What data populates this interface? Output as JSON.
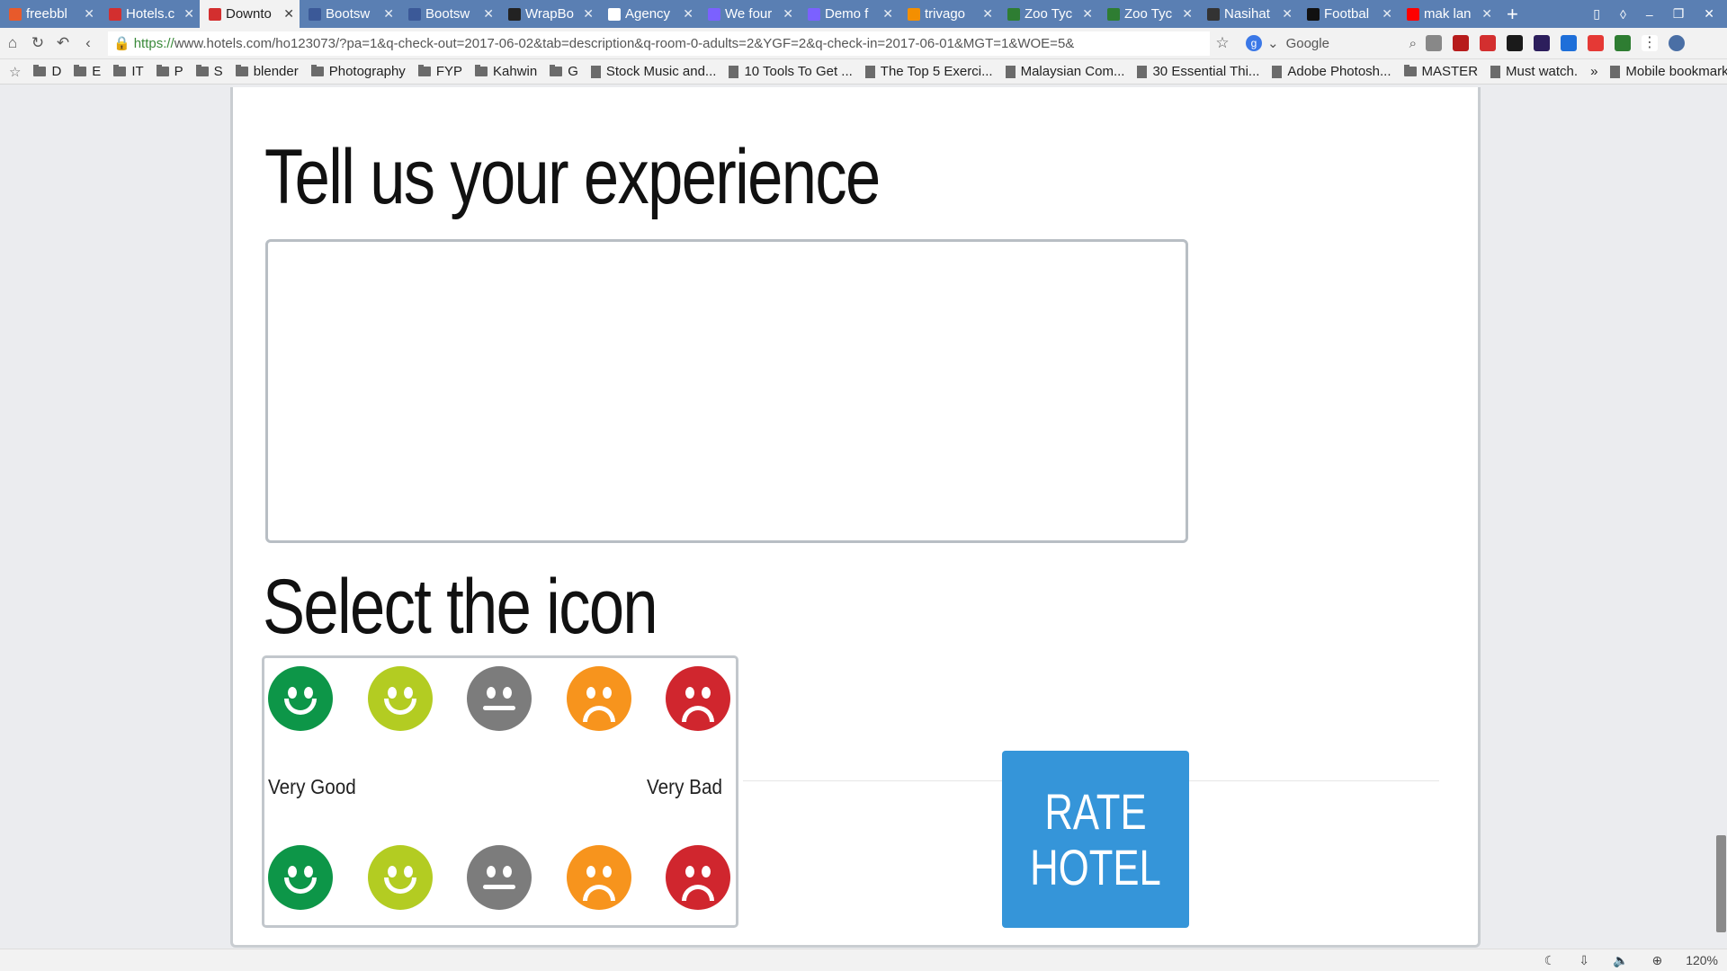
{
  "tabs": [
    {
      "label": "freebbl",
      "color": "#e85a2b",
      "active": false
    },
    {
      "label": "Hotels.c",
      "color": "#d32f2f",
      "active": false
    },
    {
      "label": "Downto",
      "color": "#d32f2f",
      "active": true
    },
    {
      "label": "Bootsw",
      "color": "#3b5998",
      "active": false
    },
    {
      "label": "Bootsw",
      "color": "#3b5998",
      "active": false
    },
    {
      "label": "WrapBo",
      "color": "#222222",
      "active": false
    },
    {
      "label": "Agency",
      "color": "#ffffff",
      "active": false
    },
    {
      "label": "We four",
      "color": "#7b61ff",
      "active": false
    },
    {
      "label": "Demo f",
      "color": "#7b61ff",
      "active": false
    },
    {
      "label": "trivago",
      "color": "#f48f00",
      "active": false
    },
    {
      "label": "Zoo Tyc",
      "color": "#2e7d32",
      "active": false
    },
    {
      "label": "Zoo Tyc",
      "color": "#2e7d32",
      "active": false
    },
    {
      "label": "Nasihat",
      "color": "#333333",
      "active": false
    },
    {
      "label": "Footbal",
      "color": "#111111",
      "active": false
    },
    {
      "label": "mak lan",
      "color": "#ff0000",
      "active": false
    }
  ],
  "toolbar": {
    "url_prefix": "https://",
    "url": "www.hotels.com/ho123073/?pa=1&q-check-out=2017-06-02&tab=description&q-room-0-adults=2&YGF=2&q-check-in=2017-06-01&MGT=1&WOE=5&",
    "search_engine": "Google"
  },
  "bookmarks": [
    {
      "label": "D",
      "type": "folder"
    },
    {
      "label": "E",
      "type": "folder"
    },
    {
      "label": "IT",
      "type": "folder"
    },
    {
      "label": "P",
      "type": "folder"
    },
    {
      "label": "S",
      "type": "folder"
    },
    {
      "label": "blender",
      "type": "folder"
    },
    {
      "label": "Photography",
      "type": "folder"
    },
    {
      "label": "FYP",
      "type": "folder"
    },
    {
      "label": "Kahwin",
      "type": "folder"
    },
    {
      "label": "G",
      "type": "folder"
    },
    {
      "label": "Stock Music and...",
      "type": "page"
    },
    {
      "label": "10 Tools To Get ...",
      "type": "page"
    },
    {
      "label": "The Top 5 Exerci...",
      "type": "page"
    },
    {
      "label": "Malaysian Com...",
      "type": "page"
    },
    {
      "label": "30 Essential Thi...",
      "type": "page"
    },
    {
      "label": "Adobe Photosh...",
      "type": "page"
    },
    {
      "label": "MASTER",
      "type": "folder"
    },
    {
      "label": "Must watch.",
      "type": "page"
    }
  ],
  "bookmarks_more": "»",
  "mobile_bookmarks": "Mobile bookmarks",
  "main": {
    "heading_experience": "Tell us your experience",
    "heading_icon": "Select the icon",
    "label_good": "Very Good",
    "label_bad": "Very Bad",
    "rate_line1": "RATE",
    "rate_line2": "HOTEL"
  },
  "faces": [
    {
      "name": "very-good",
      "mood": "smile",
      "color": "#0d9648"
    },
    {
      "name": "good",
      "mood": "smile",
      "color": "#b3cc22"
    },
    {
      "name": "neutral",
      "mood": "flat",
      "color": "#7c7c7c"
    },
    {
      "name": "bad",
      "mood": "frown",
      "color": "#f7941d"
    },
    {
      "name": "very-bad",
      "mood": "frown",
      "color": "#d0262e"
    }
  ],
  "status": {
    "zoom": "120%"
  }
}
